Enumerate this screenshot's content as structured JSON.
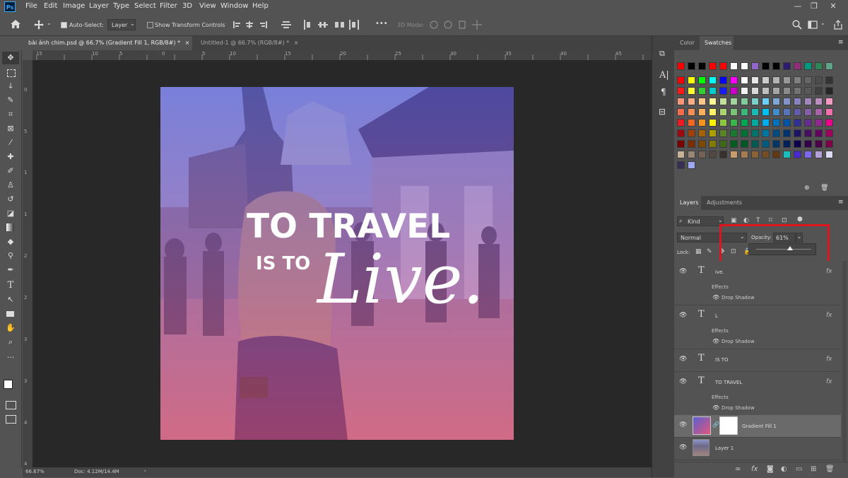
{
  "app": {
    "logo": "Ps"
  },
  "menu": [
    "File",
    "Edit",
    "Image",
    "Layer",
    "Type",
    "Select",
    "Filter",
    "3D",
    "View",
    "Window",
    "Help"
  ],
  "window_controls": {
    "minimize": "—",
    "restore": "❐",
    "close": "✕"
  },
  "options_bar": {
    "auto_select_label": "Auto-Select:",
    "auto_select_value": "Layer",
    "show_transform_label": "Show Transform Controls",
    "mode_3d_label": "3D Mode:",
    "more": "•••"
  },
  "tabs": [
    {
      "label": "bài ảnh chim.psd @ 66.7% (Gradient Fill 1, RGB/8#) *",
      "close": "×",
      "active": true
    },
    {
      "label": "Untitled-1 @ 66.7% (RGB/8#) *",
      "close": "×",
      "active": false
    }
  ],
  "ruler_top": [
    "15",
    "10",
    "5",
    "0",
    "5",
    "10",
    "15",
    "20",
    "25",
    "30",
    "35",
    "40",
    "45"
  ],
  "ruler_left": [
    "0",
    "5",
    "1",
    "1",
    "2",
    "2",
    "3",
    "3",
    "4",
    "4"
  ],
  "artwork": {
    "line1": "TO TRAVEL",
    "line2": "IS TO",
    "script": "Live."
  },
  "status": {
    "zoom": "66.67%",
    "doc": "Doc: 4.12M/14.4M",
    "arrow": "›"
  },
  "panels": {
    "color_tab": "Color",
    "swatches_tab": "Swatches",
    "swatch_rows": [
      [
        "#ff0000",
        "#000000",
        "#000000",
        "#ff0000",
        "#ff0000",
        "#ffffff",
        "#ffffff",
        "#9266cc",
        "#000000",
        "#000000",
        "#2e1a6e",
        "#922d7a",
        "#009980",
        "#2f8557",
        "#5fa389"
      ],
      [
        "#ff0000",
        "#ffff00",
        "#00ff00",
        "#00ffff",
        "#0000ff",
        "#ff00ff",
        "#ffffff",
        "#e6e6e6",
        "#cccccc",
        "#b3b3b3",
        "#999999",
        "#808080",
        "#666666",
        "#4d4d4d",
        "#333333"
      ],
      [
        "#ff1a1a",
        "#ffff33",
        "#33cc33",
        "#00cccc",
        "#1a1aff",
        "#cc00cc",
        "#f2f2f2",
        "#d9d9d9",
        "#bfbfbf",
        "#a6a6a6",
        "#8c8c8c",
        "#737373",
        "#595959",
        "#404040",
        "#262626"
      ],
      [
        "#f7977a",
        "#f9ad81",
        "#fdc68a",
        "#fff79a",
        "#c4df9b",
        "#a2d39c",
        "#82ca9d",
        "#7bcdc8",
        "#6ecff6",
        "#7ea7d8",
        "#8493ca",
        "#8882be",
        "#a187be",
        "#bc8dbf",
        "#f49ac2"
      ],
      [
        "#f26c4f",
        "#f68e55",
        "#fbaf5c",
        "#fff467",
        "#acd372",
        "#7cc576",
        "#3bb878",
        "#1abbb4",
        "#00bff3",
        "#438cca",
        "#5574b9",
        "#605ca8",
        "#855fa8",
        "#a763a8",
        "#f06ea9"
      ],
      [
        "#ed1c24",
        "#f26522",
        "#f7941d",
        "#fff200",
        "#8dc73f",
        "#39b54a",
        "#00a651",
        "#00a99d",
        "#00aeef",
        "#0072bc",
        "#0054a5",
        "#2e3192",
        "#662d91",
        "#92278f",
        "#ec008c"
      ],
      [
        "#9e0b0f",
        "#a0410d",
        "#a3620a",
        "#aba000",
        "#598527",
        "#1a7b30",
        "#007236",
        "#00746b",
        "#0076a3",
        "#004b80",
        "#003471",
        "#1b1464",
        "#440e62",
        "#630460",
        "#9e005d"
      ],
      [
        "#790000",
        "#7b2e00",
        "#7d4900",
        "#827b00",
        "#406618",
        "#005e20",
        "#005826",
        "#005952",
        "#005b7f",
        "#003663",
        "#002157",
        "#0d004c",
        "#32004b",
        "#4b0049",
        "#7b0046"
      ],
      [
        "#c7b299",
        "#998675",
        "#736357",
        "#534741",
        "#37302d",
        "#c69c6d",
        "#a67c52",
        "#8c6239",
        "#754c24",
        "#603913",
        "#1abcbc",
        "#4a2ad0",
        "#7b68ee",
        "#b2a0d6",
        "#dadaf5"
      ],
      [
        "#372e58",
        "#9fa8f5"
      ]
    ],
    "layers_tab": "Layers",
    "adjustments_tab": "Adjustments",
    "kind_label": "Kind",
    "blend_mode": "Normal",
    "opacity_label": "Opacity:",
    "opacity_value": "61%",
    "opacity_fraction": 0.61,
    "lock_label": "Lock:",
    "layers": [
      {
        "name": "ive.",
        "type": "text",
        "fx": "fx",
        "effects_label": "Effects",
        "effect": "Drop Shadow"
      },
      {
        "name": "L",
        "type": "text",
        "fx": "fx",
        "effects_label": "Effects",
        "effect": "Drop Shadow"
      },
      {
        "name": "IS TO",
        "type": "text",
        "fx": "fx"
      },
      {
        "name": "TO TRAVEL",
        "type": "text",
        "fx": "fx",
        "effects_label": "Effects",
        "effect": "Drop Shadow"
      },
      {
        "name": "Gradient Fill 1",
        "type": "gradient",
        "selected": true
      },
      {
        "name": "Layer 1",
        "type": "image"
      }
    ]
  },
  "colors": {
    "highlight_box": "#e0141c",
    "gradient_top": "#5a5fd0",
    "gradient_bottom": "#e0577a",
    "panel_bg": "#535353",
    "canvas_bg": "#282828"
  }
}
